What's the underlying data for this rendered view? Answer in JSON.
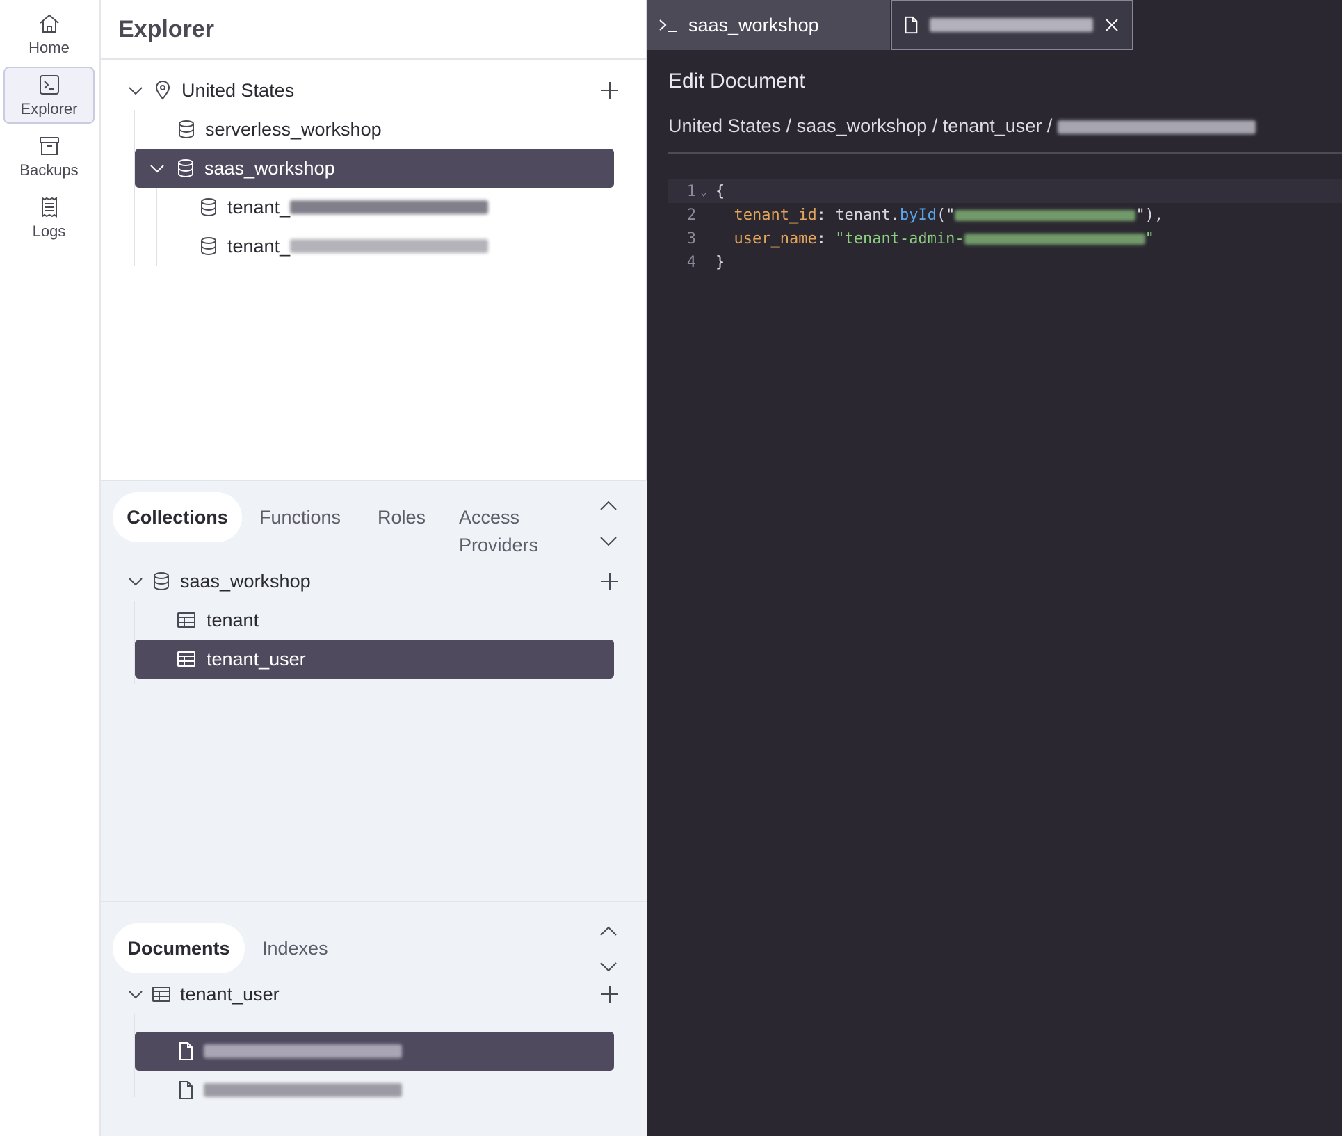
{
  "nav": {
    "items": [
      {
        "label": "Home",
        "icon": "home-icon"
      },
      {
        "label": "Explorer",
        "icon": "terminal-icon",
        "active": true
      },
      {
        "label": "Backups",
        "icon": "archive-icon"
      },
      {
        "label": "Logs",
        "icon": "receipt-icon"
      }
    ]
  },
  "explorer": {
    "title": "Explorer",
    "region": "United States",
    "databases": [
      "serverless_workshop",
      "saas_workshop"
    ],
    "children": [
      {
        "prefix": "tenant_"
      },
      {
        "prefix": "tenant_"
      }
    ]
  },
  "collections_section": {
    "tabs": [
      "Collections",
      "Functions",
      "Roles",
      "Access",
      "Providers"
    ],
    "database": "saas_workshop",
    "items": [
      "tenant",
      "tenant_user"
    ]
  },
  "documents_section": {
    "tabs": [
      "Documents",
      "Indexes"
    ],
    "collection": "tenant_user"
  },
  "editor": {
    "tabs": [
      {
        "label": "saas_workshop"
      }
    ],
    "title": "Edit Document",
    "breadcrumb": "United States / saas_workshop / tenant_user / ",
    "code": {
      "line_numbers": [
        "1",
        "2",
        "3",
        "4"
      ],
      "open_brace": "{",
      "key1": "tenant_id",
      "obj": "tenant",
      "dot": ".",
      "func": "byId",
      "paren_open": "(\"",
      "paren_close": "\"),",
      "key2": "user_name",
      "colon": ": ",
      "str_prefix": "\"tenant-admin-",
      "quote": "\"",
      "close_brace": "}"
    }
  },
  "colors": {
    "selected_row": "#504a5f",
    "editor_bg": "#2a2731",
    "section_bg": "#eff3f7",
    "code_key": "#e3a55a",
    "code_func": "#5aa6e8",
    "code_string": "#8ccf7e"
  }
}
